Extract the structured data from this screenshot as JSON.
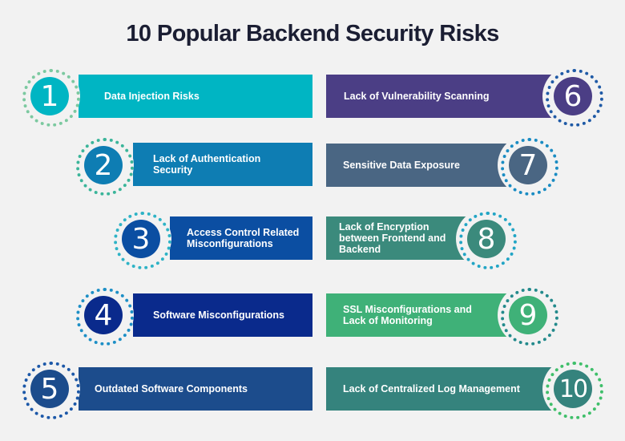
{
  "title": "10 Popular Backend Security Risks",
  "items": [
    {
      "number": "1",
      "label": "Data Injection Risks",
      "color": "#00b5c3",
      "dot_color": "#7cc9a0"
    },
    {
      "number": "2",
      "label": "Lack of Authentication Security",
      "color": "#0e7db3",
      "dot_color": "#3bb59a"
    },
    {
      "number": "3",
      "label": "Access Control Related Misconfigurations",
      "color": "#0b4ea2",
      "dot_color": "#2eb3c6"
    },
    {
      "number": "4",
      "label": "Software Misconfigurations",
      "color": "#0a2a8c",
      "dot_color": "#1d8fc6"
    },
    {
      "number": "5",
      "label": "Outdated Software Components",
      "color": "#1c4c8c",
      "dot_color": "#1c58a8"
    },
    {
      "number": "6",
      "label": "Lack of Vulnerability Scanning",
      "color": "#4b3e85",
      "dot_color": "#1f5aa6"
    },
    {
      "number": "7",
      "label": "Sensitive Data Exposure",
      "color": "#4a6683",
      "dot_color": "#1a8cc3"
    },
    {
      "number": "8",
      "label": "Lack of Encryption between Frontend and Backend",
      "color": "#3b8a7c",
      "dot_color": "#22a5c5"
    },
    {
      "number": "9",
      "label": "SSL Misconfigurations and Lack of Monitoring",
      "color": "#3fb178",
      "dot_color": "#238a8c"
    },
    {
      "number": "10",
      "label": "Lack of Centralized Log Management",
      "color": "#35837d",
      "dot_color": "#3fbf6a"
    }
  ]
}
